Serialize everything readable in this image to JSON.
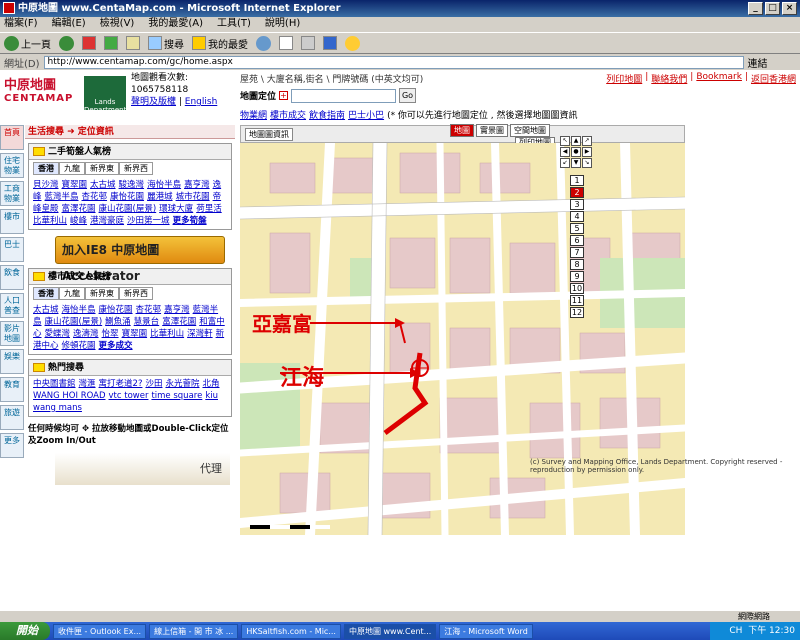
{
  "window": {
    "title": "中原地圖 www.CentaMap.com - Microsoft Internet Explorer",
    "buttons": [
      "_",
      "□",
      "×"
    ]
  },
  "menu": [
    "檔案(F)",
    "編輯(E)",
    "檢視(V)",
    "我的最愛(A)",
    "工具(T)",
    "說明(H)"
  ],
  "toolbar": {
    "back": "上一頁",
    "search": "搜尋",
    "favorites": "我的最愛"
  },
  "address": {
    "label": "網址(D)",
    "url": "http://www.centamap.com/gc/home.aspx",
    "links": "連結"
  },
  "header": {
    "logo_cn": "中原地圖",
    "logo_en": "CENTAMAP",
    "lands_dept": "Lands Department",
    "visits_label": "地圖觀看次數:",
    "visits": "1065758118",
    "disclaimer": "聲明及版權",
    "english": "English",
    "top_nav": "屋苑 \\ 大廈名稱,街名 \\ 門牌號碼 (中英文均可)",
    "top_links": [
      "列印地圖",
      "聯絡我們",
      "Bookmark",
      "返回香港網"
    ]
  },
  "locate": {
    "label": "地圖定位",
    "go": "Go",
    "hint": "(* 你可以先進行地圖定位 , 然後選擇地圖圖資訊"
  },
  "subnav": [
    "物業網",
    "樓市成交",
    "飲食指南",
    "巴士小巴"
  ],
  "side_tabs": [
    "首頁",
    "住宅物業",
    "工商物業",
    "樓市",
    "巴士",
    "飲食",
    "人口普查",
    "影片地圖",
    "娛樂",
    "教育",
    "旅遊",
    "更多"
  ],
  "left": {
    "heading": "生活搜尋 ➜ 定位資訊",
    "hot_properties": {
      "title": "二手筍盤人氣榜",
      "tabs": [
        "香港",
        "九龍",
        "新界東",
        "新界西"
      ],
      "items": [
        "貝沙灣",
        "寶翠園",
        "太古城",
        "駿逸灣",
        "海怡半島",
        "嘉亨灣",
        "逸峰",
        "藍灣半島",
        "杏花邨",
        "康怡花園",
        "麗港城",
        "城市花園",
        "帝峰皇殿",
        "富澤花園",
        "康山花園(屋景)",
        "環球大廈",
        "荷里活",
        "比華利山",
        "峻峰",
        "港灣豪庭",
        "沙田第一城"
      ],
      "more": "更多筍盤"
    },
    "accelerator": "加入IE8 中原地圖 Accelerator",
    "transactions": {
      "title": "樓市成交人氣榜",
      "tabs": [
        "香港",
        "九龍",
        "新界東",
        "新界西"
      ],
      "items": [
        "太古城",
        "海怡半島",
        "康怡花園",
        "杏花邨",
        "嘉亨灣",
        "藍灣半島",
        "康山花園(屋景)",
        "鰂魚涌",
        "慧景台",
        "富澤花園",
        "和富中心",
        "愛蝶灣",
        "逸濤灣",
        "怡翠",
        "寶翠園",
        "比華利山",
        "深灣軒",
        "新港中心",
        "修頓花園"
      ],
      "more": "更多成交"
    },
    "hot_search": {
      "title": "熱門搜尋",
      "items": [
        "中央圖書館",
        "灣滙",
        "寓打老道2?",
        "沙田",
        "永光薈院",
        "北角",
        "WANG HOI ROAD",
        "vtc tower",
        "time square",
        "kiu wang mans"
      ]
    },
    "tip": "任何時候均可 ✥ 拉放移動地圖或Double-Click定位及Zoom In/Out",
    "agent": "代理"
  },
  "map": {
    "info_button": "地圖圖資訊",
    "tabs": [
      "地圖",
      "實景圖",
      "空間地圖",
      "列印地圖"
    ],
    "zoom_levels": [
      "1",
      "2",
      "3",
      "4",
      "5",
      "6",
      "7",
      "8",
      "9",
      "10",
      "11",
      "12"
    ],
    "zoom_current": "2",
    "nav": [
      "↖",
      "▲",
      "↗",
      "◀",
      "●",
      "▶",
      "↙",
      "▼",
      "↘"
    ],
    "credit": "(c) Survey and Mapping Office, Lands Department. Copyright reserved - reproduction by permission only.",
    "annotation1": "亞嘉富",
    "annotation2": "江海"
  },
  "status": {
    "left": "",
    "right": "網際網路"
  },
  "taskbar": {
    "start": "開始",
    "tasks": [
      "收件匣 - Outlook Ex...",
      "線上信箱 - 開 市 冰 ...",
      "HKSaltfish.com - Mic...",
      "中原地圖 www.Cent...",
      "江海 - Microsoft Word"
    ],
    "lang": "CH",
    "clock": "下午 12:30"
  }
}
